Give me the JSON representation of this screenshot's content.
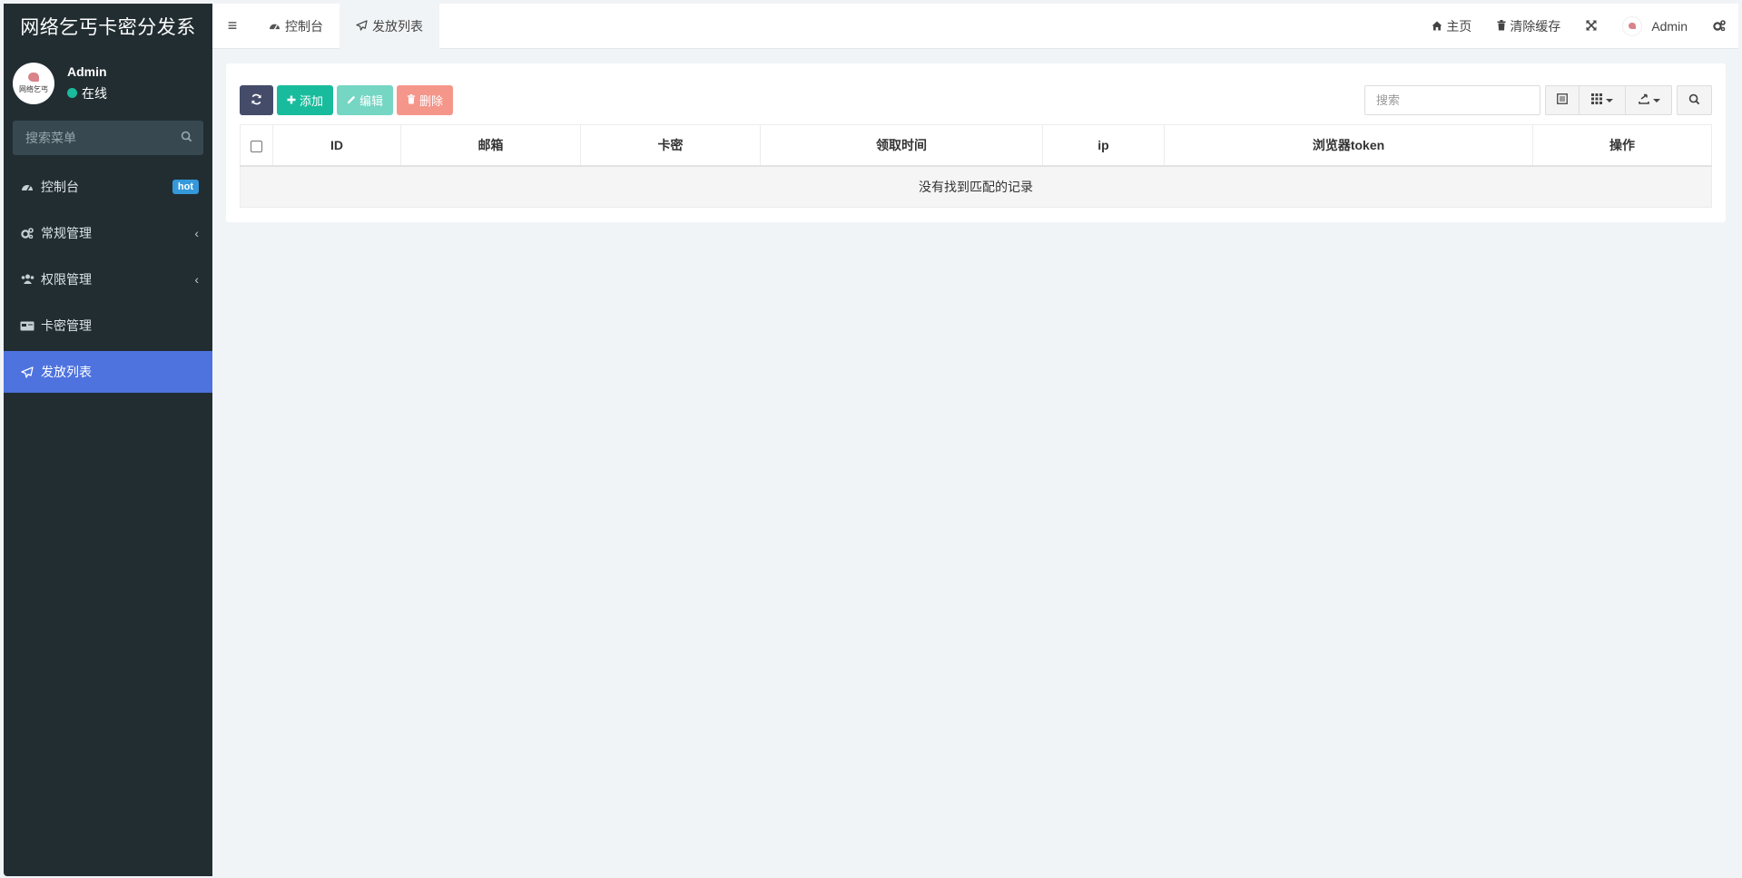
{
  "app": {
    "title": "网络乞丐卡密分发系",
    "avatar_text": "网络乞丐"
  },
  "user": {
    "name": "Admin",
    "status": "在线"
  },
  "sidebar": {
    "search_placeholder": "搜索菜单",
    "items": [
      {
        "label": "控制台",
        "icon": "dashboard-icon",
        "badge": "hot"
      },
      {
        "label": "常规管理",
        "icon": "cogs-icon"
      },
      {
        "label": "权限管理",
        "icon": "users-icon"
      },
      {
        "label": "卡密管理",
        "icon": "card-icon"
      },
      {
        "label": "发放列表",
        "icon": "paper-plane-icon",
        "active": true
      }
    ]
  },
  "topbar": {
    "tabs": [
      {
        "label": "控制台",
        "icon": "dashboard-icon"
      },
      {
        "label": "发放列表",
        "icon": "paper-plane-icon",
        "active": true
      }
    ],
    "home": "主页",
    "clear_cache": "清除缓存",
    "user": "Admin"
  },
  "toolbar": {
    "add": "添加",
    "edit": "编辑",
    "delete": "删除"
  },
  "search": {
    "placeholder": "搜索"
  },
  "table": {
    "columns": [
      "ID",
      "邮箱",
      "卡密",
      "领取时间",
      "ip",
      "浏览器token",
      "操作"
    ],
    "empty_text": "没有找到匹配的记录"
  },
  "colors": {
    "accent": "#4e73df",
    "success": "#18bc9c",
    "sidebar": "#222d32"
  }
}
